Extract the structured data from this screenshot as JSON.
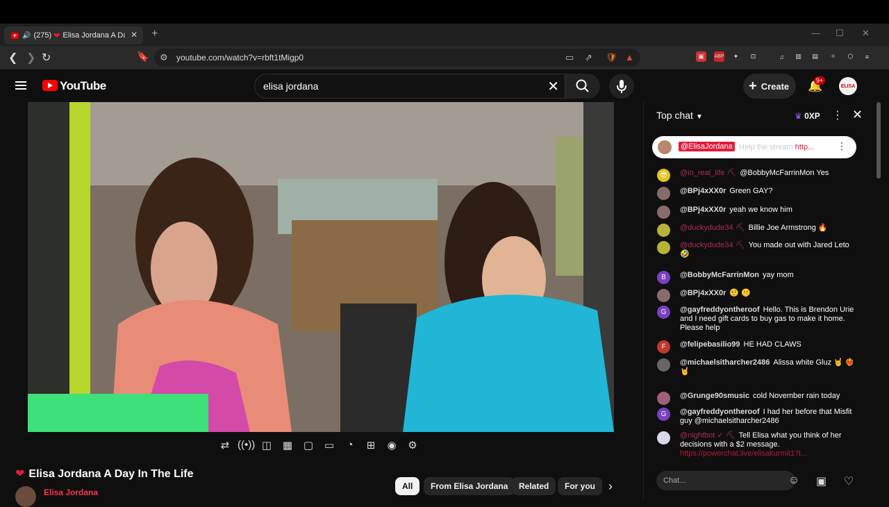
{
  "browser": {
    "tab": {
      "count": "(275)",
      "title": "Elisa Jordana A Day",
      "close": "✕"
    },
    "new_tab": "+",
    "window_controls": {
      "minimize": "—",
      "maximize": "☐",
      "close": "✕"
    },
    "url": "youtube.com/watch?v=rbft1tMigp0",
    "ext_badge_brave": "5",
    "ext_badge_alert": "1"
  },
  "youtube": {
    "logo_text": "YouTube",
    "search_query": "elisa jordana",
    "create_label": "Create",
    "notif_badge": "9+",
    "avatar_text": "ELISA"
  },
  "video": {
    "title": "Elisa Jordana A Day In The Life",
    "channel": "Elisa Jordana"
  },
  "chips": [
    "All",
    "From Elisa Jordana",
    "Related",
    "For you"
  ],
  "chat": {
    "header": "Top chat",
    "xp": "0XP",
    "pinned": {
      "author": "@ElisaJordana",
      "text": "Help the stream",
      "link": "http..."
    },
    "messages": [
      {
        "author": "@in_real_life",
        "text": "@BobbyMcFarrinMon Yes",
        "mod": true,
        "color": "#e6c21e",
        "initial": "😎"
      },
      {
        "author": "@BPj4xXX0r",
        "text": "Green GAY?",
        "mod": false,
        "color": "#8a6b6b",
        "initial": ""
      },
      {
        "author": "@BPj4xXX0r",
        "text": "yeah we know him",
        "mod": false,
        "color": "#8a6b6b",
        "initial": ""
      },
      {
        "author": "@duckydude34",
        "text": "Billie Joe Armstrong 🔥",
        "mod": true,
        "color": "#b8b13a",
        "initial": ""
      },
      {
        "author": "@duckydude34",
        "text": "You made out with Jared Leto 🤣",
        "mod": true,
        "color": "#b8b13a",
        "initial": ""
      },
      {
        "author": "@BobbyMcFarrinMon",
        "text": "yay mom",
        "mod": false,
        "color": "#7b3fbf",
        "initial": "B"
      },
      {
        "author": "@BPj4xXX0r",
        "text": "🤨 🤫",
        "mod": false,
        "color": "#8a6b6b",
        "initial": ""
      },
      {
        "author": "@gayfreddyontheroof",
        "text": "Hello. This is Brendon Urie and I need gift cards to buy gas to make it home. Please help",
        "mod": false,
        "color": "#7b3fbf",
        "initial": "G"
      },
      {
        "author": "@felipebasilio99",
        "text": "HE HAD CLAWS",
        "mod": false,
        "color": "#c0392b",
        "initial": "F"
      },
      {
        "author": "@michaelsitharcher2486",
        "text": "Alissa white Gluz 🤘 ❤️‍🔥 🤘",
        "mod": false,
        "color": "#666666",
        "initial": ""
      },
      {
        "author": "@Grunge90smusic",
        "text": "cold November rain today",
        "mod": false,
        "color": "#a0607a",
        "initial": ""
      },
      {
        "author": "@gayfreddyontheroof",
        "text": "I had her before that Misfit guy @michaelsitharcher2486",
        "mod": false,
        "color": "#7b3fbf",
        "initial": "G"
      },
      {
        "author": "@nightbot ✓",
        "text": "Tell Elisa what you think of her decisions with a $2 message.",
        "link": "https://powerchat.live/elisakurmit1?l...",
        "mod": true,
        "color": "#d8d8e8",
        "initial": ""
      }
    ],
    "input_placeholder": "Chat..."
  }
}
